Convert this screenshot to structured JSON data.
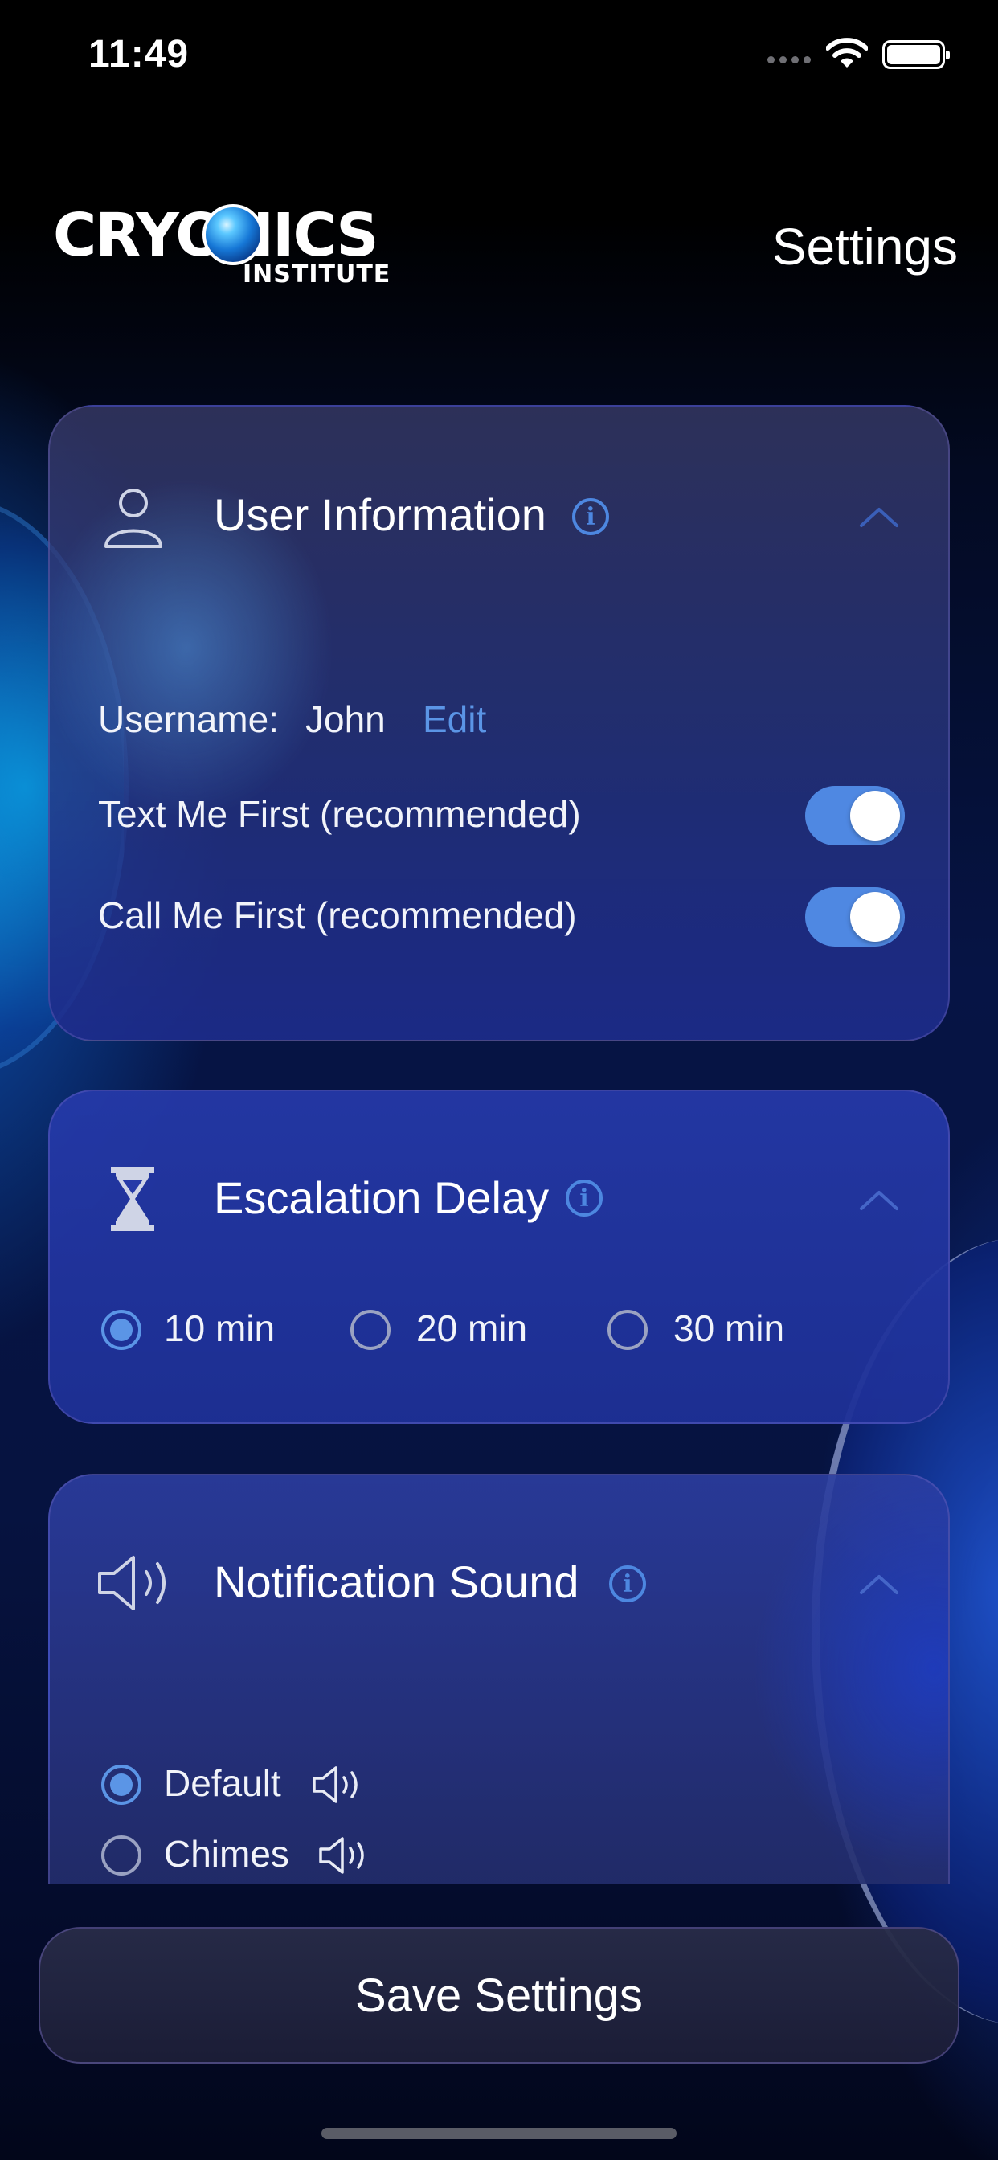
{
  "status_bar": {
    "time": "11:49"
  },
  "header": {
    "logo_main": "CRYONICS",
    "logo_sub": "INSTITUTE",
    "title": "Settings"
  },
  "user_info": {
    "title": "User Information",
    "username_label": "Username:",
    "username_value": "John",
    "edit_label": "Edit",
    "text_me_first_label": "Text Me First (recommended)",
    "text_me_first_on": true,
    "call_me_first_label": "Call Me First (recommended)",
    "call_me_first_on": true
  },
  "escalation_delay": {
    "title": "Escalation Delay",
    "options": [
      "10 min",
      "20 min",
      "30 min"
    ],
    "selected": "10 min"
  },
  "notification_sound": {
    "title": "Notification Sound",
    "options": [
      "Default",
      "Chimes"
    ],
    "selected": "Default"
  },
  "save_button_label": "Save Settings",
  "colors": {
    "accent": "#5b95e6",
    "toggle_on": "#4f88e2",
    "card_delay": "#263aa8",
    "background": "#061445"
  },
  "icons": [
    "person-icon",
    "info-icon",
    "chevron-up-icon",
    "hourglass-icon",
    "speaker-icon",
    "wifi-icon",
    "battery-icon"
  ]
}
